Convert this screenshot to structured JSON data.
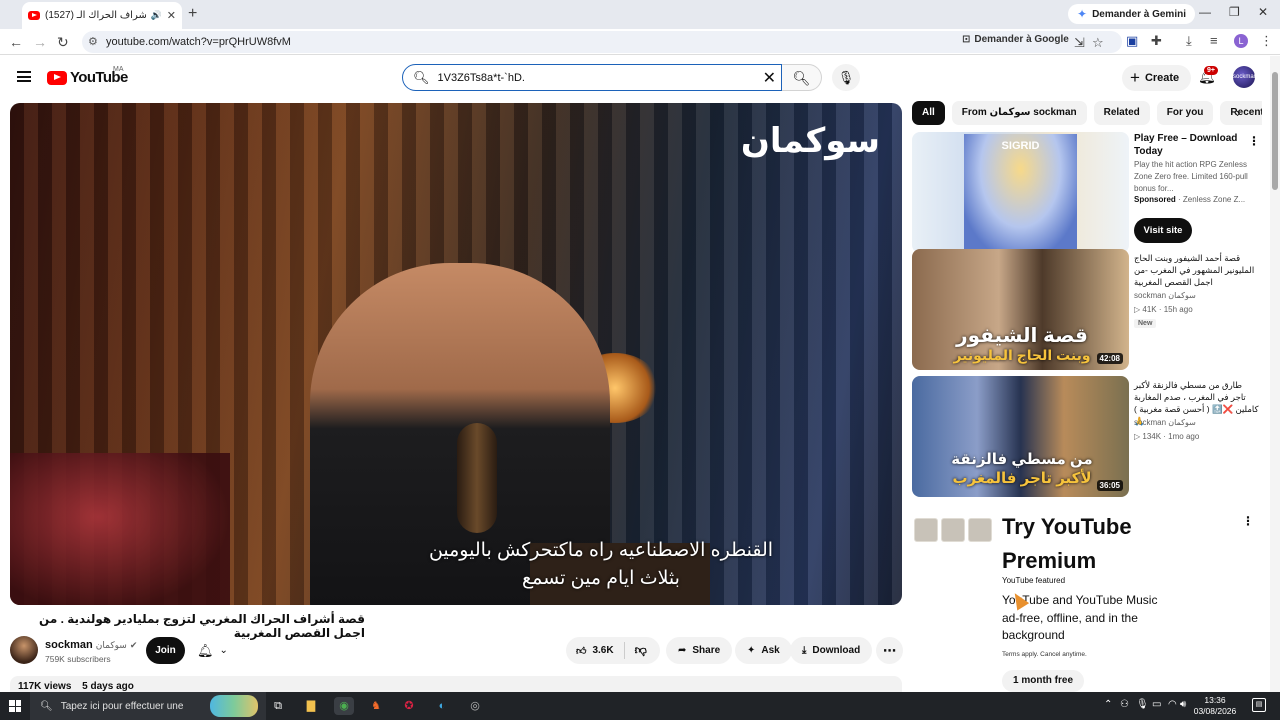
{
  "browser": {
    "tab_title": "(1527) قصة أشراف الحراك الـ",
    "new_tab_label": "+",
    "gemini_label": "Demander à Gemini",
    "url": "youtube.com/watch?v=prQHrUW8fvM",
    "ask_google_label": "Demander à Google",
    "profile_initial": "L",
    "window_controls": [
      "—",
      "❐",
      "✕"
    ]
  },
  "youtube": {
    "logo_text": "YouTube",
    "region": "MA",
    "search_value": "1V3Z6Ts8a*t-`hD.",
    "create_label": "Create",
    "notif_count": "9+",
    "channel_avatar_text": "sockman"
  },
  "video": {
    "brand_overlay": "سوكمان",
    "subtitle_line1": "القنطره الاصطناعيه راه ماكتحركش باليومين",
    "subtitle_line2": "بثلاث ايام مين تسمع",
    "title": "قصة أشراف الحراك المغربي لتزوج بمليادير هولندية . من اجمل القصص المغربية",
    "channel_name": "sockman",
    "channel_name_ar": "سوكمان",
    "subscribers": "759K subscribers",
    "join_label": "Join",
    "likes": "3.6K",
    "share_label": "Share",
    "ask_label": "Ask",
    "download_label": "Download",
    "views": "117K views",
    "age": "5 days ago"
  },
  "sidebar": {
    "chips": [
      "All",
      "From سوكمان sockman",
      "Related",
      "For you",
      "Recently uploaded"
    ],
    "ad": {
      "thumb_title": "SIGRID",
      "title": "Play Free – Download Today",
      "body": "Play the hit action RPG Zenless Zone Zero free. Limited 160-pull bonus for...",
      "sponsored": "Sponsored",
      "advertiser": "· Zenless Zone Z...",
      "button": "Visit site"
    },
    "videos": [
      {
        "title": "قصة أحمد الشيفور وبنت الحاج المليونير المشهور في المغرب -من اجمل القصص المغربية",
        "channel": "sockman سوكمان",
        "meta": "▷ 41K · 15h ago",
        "badge": "New",
        "duration": "42:08",
        "thumb_line1": "قصة الشيفور",
        "thumb_line2": "وبنت الحاج المليونير"
      },
      {
        "title": "طارق من مسطي فالزنقة لأكبر تاجر في المغرب ، صدم المغاربة كاملين ❌🔝 ( أحسن قصة مغربية ) 🙏",
        "channel": "sockman سوكمان",
        "meta": "▷ 134K · 1mo ago",
        "badge": "",
        "duration": "36:05",
        "thumb_line1": "من مسطي فالزنقة",
        "thumb_line2": "لأكبر تاجر فالمغرب"
      }
    ],
    "premium": {
      "title": "Try YouTube Premium",
      "featured": "YouTube featured",
      "body": "YouTube and YouTube Music ad-free, offline, and in the background",
      "terms": "Terms apply. Cancel anytime.",
      "button": "1 month free"
    }
  },
  "taskbar": {
    "search_placeholder": "Tapez ici pour effectuer une",
    "time": "13:36",
    "date": "03/08/2026"
  },
  "icons": {
    "back": "arrow-left-icon",
    "forward": "arrow-right-icon",
    "reload": "reload-icon",
    "search": "search-icon",
    "mic": "mic-icon",
    "bell": "bell-icon",
    "like": "thumbs-up-icon",
    "dislike": "thumbs-down-icon",
    "share": "share-icon",
    "download": "download-icon"
  },
  "colors": {
    "yt_red": "#ff0000",
    "badge_red": "#cc0000",
    "chip_selected": "#0f0f0f",
    "taskbar": "#202327"
  }
}
